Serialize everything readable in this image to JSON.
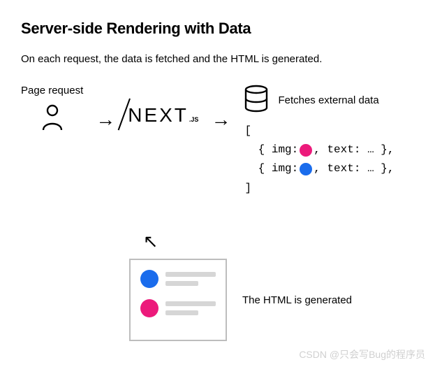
{
  "title": "Server-side Rendering with Data",
  "subtitle": "On each request, the data is fetched and the HTML is generated.",
  "labels": {
    "page_request": "Page request",
    "fetches_data": "Fetches external data",
    "html_generated": "The HTML is generated"
  },
  "logo": {
    "text": "NEXT",
    "suffix": ".JS"
  },
  "code": {
    "open": "[",
    "row1_pre": "  { img:",
    "row1_post": ", text: … },",
    "row2_pre": "  { img:",
    "row2_post": ", text: … },",
    "close": "]"
  },
  "colors": {
    "pink": "#ec1a7b",
    "blue": "#1a6cec"
  },
  "watermark": "CSDN @只会写Bug的程序员"
}
